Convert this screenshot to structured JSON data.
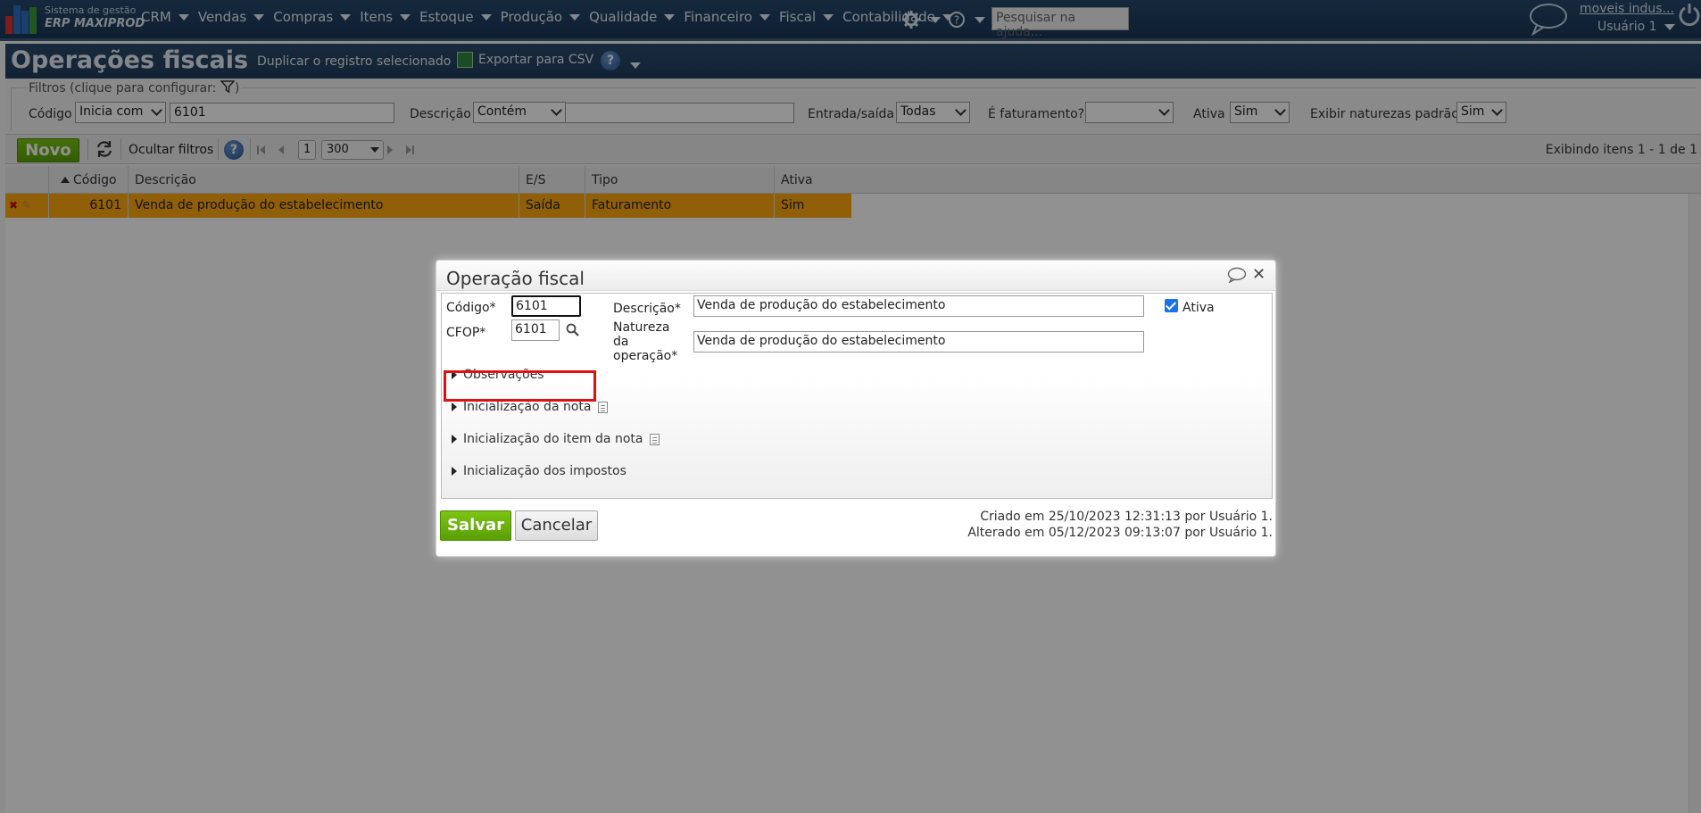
{
  "app": {
    "logo_line1": "Sistema de gestão",
    "logo_line2": "ERP MAXIPROD",
    "menu": [
      "CRM",
      "Vendas",
      "Compras",
      "Itens",
      "Estoque",
      "Produção",
      "Qualidade",
      "Financeiro",
      "Fiscal",
      "Contabilidade"
    ],
    "search_placeholder": "Pesquisar na ajuda...",
    "company": "moveis indus...",
    "user": "Usuário 1"
  },
  "page": {
    "title": "Operações fiscais",
    "duplicate_action": "Duplicar o registro selecionado",
    "export_action": "Exportar para CSV",
    "help": "?"
  },
  "filters": {
    "legend": "Filtros (clique para configurar:",
    "legend_close": ")",
    "codigo_label": "Código",
    "codigo_op": "Inicia com",
    "codigo_value": "6101",
    "descricao_label": "Descrição",
    "descricao_op": "Contém",
    "descricao_value": "",
    "entrada_label": "Entrada/saída",
    "entrada_value": "Todas",
    "faturamento_label": "É faturamento?",
    "faturamento_value": "",
    "ativa_label": "Ativa",
    "ativa_value": "Sim",
    "naturezas_label": "Exibir naturezas padrão",
    "naturezas_value": "Sim"
  },
  "toolbar": {
    "novo": "Novo",
    "hide_filters": "Ocultar filtros",
    "page": "1",
    "page_size": "300",
    "showing": "Exibindo itens 1 - 1 de 1"
  },
  "grid": {
    "columns": [
      "Código",
      "Descrição",
      "E/S",
      "Tipo",
      "Ativa"
    ],
    "rows": [
      {
        "codigo": "6101",
        "descricao": "Venda de produção do estabelecimento",
        "es": "Saída",
        "tipo": "Faturamento",
        "ativa": "Sim"
      }
    ]
  },
  "modal": {
    "title": "Operação fiscal",
    "codigo_label": "Código*",
    "codigo_value": "6101",
    "cfop_label": "CFOP*",
    "cfop_value": "6101",
    "descricao_label": "Descrição*",
    "descricao_value": "Venda de produção do estabelecimento",
    "natureza_label_1": "Natureza",
    "natureza_label_2": "da",
    "natureza_label_3": "operação*",
    "natureza_value": "Venda de produção do estabelecimento",
    "ativa_label": "Ativa",
    "ativa_checked": true,
    "sections": [
      "Observações",
      "Inicialização da nota",
      "Inicialização do item da nota",
      "Inicialização dos impostos"
    ],
    "save": "Salvar",
    "cancel": "Cancelar",
    "created": "Criado em 25/10/2023 12:31:13 por Usuário 1.",
    "changed": "Alterado em 05/12/2023 09:13:07 por Usuário 1."
  },
  "colors": {
    "nav_bg": "#1d3d5e",
    "accent_green": "#6ab40e",
    "selected_row": "#fda80f",
    "highlight_red": "#e01010",
    "checkbox_blue": "#1a73e8"
  }
}
